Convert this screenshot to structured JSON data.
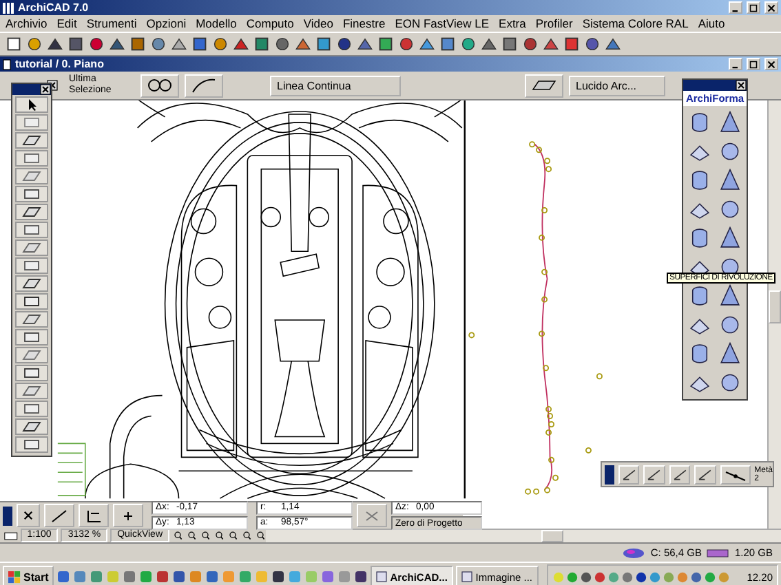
{
  "window": {
    "title": "ArchiCAD 7.0"
  },
  "menu": [
    "Archivio",
    "Edit",
    "Strumenti",
    "Opzioni",
    "Modello",
    "Computo",
    "Video",
    "Finestre",
    "EON FastView LE",
    "Extra",
    "Profiler",
    "Sistema Colore RAL",
    "Aiuto"
  ],
  "document": {
    "title": "tutorial / 0. Piano"
  },
  "info_box": {
    "selection": "Ultima Selezione",
    "line_type": "Linea Continua",
    "layer": "Lucido Arc..."
  },
  "archiforma": {
    "title": "ArchiForma",
    "tooltip": "SUPERFICI DI RIVOLUZIONE"
  },
  "snap_palette": {
    "label": "Metà",
    "value": "2"
  },
  "coordinates": {
    "groups": [
      {
        "fields": [
          {
            "label": "Δx:",
            "value": "-0,17"
          },
          {
            "label": "Δy:",
            "value": "1,13"
          }
        ]
      },
      {
        "fields": [
          {
            "label": "r:",
            "value": "1,14"
          },
          {
            "label": "a:",
            "value": "98,57°"
          }
        ]
      }
    ],
    "dz": {
      "label": "Δz:",
      "value": "0,00"
    },
    "reference": "Zero di Progetto"
  },
  "status_bar": {
    "scale": "1:100",
    "zoom": "3132 %",
    "view": "QuickView"
  },
  "system_info": {
    "disk": "C: 56,4 GB",
    "memory": "1.20 GB"
  },
  "taskbar": {
    "start": "Start",
    "tasks": [
      {
        "label": "ArchiCAD...",
        "selected": true
      },
      {
        "label": "Immagine ...",
        "selected": false
      }
    ],
    "clock": "12.20"
  }
}
